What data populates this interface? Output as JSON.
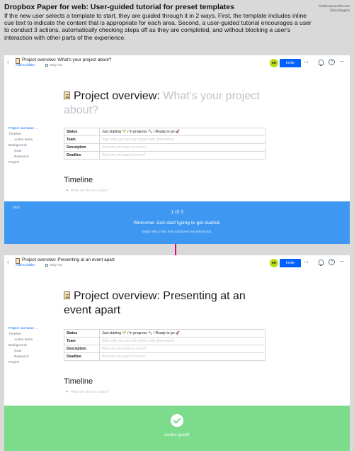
{
  "header": {
    "title": "Dropbox Paper for web: User-guided tutorial for preset templates",
    "description": "If the new user selects a template to start, they are guided through it in 2 ways. First, the template includes inline cue text to indicate the content that is appropriate for each area. Second, a user-guided tutorial encourages a user to conduct 3 actions, automatically checking steps off as they are completed, and without blocking a user's interaction with other parts of the experience.",
    "credit_line1": "firstlinesw.tumblr.com",
    "credit_line2": "@nicetriggins"
  },
  "common": {
    "add_to_folder": "Add to folder",
    "only_me": "Only me",
    "avatar_initials": "KH",
    "invite_label": "Invite",
    "back_icon": "‹",
    "star_icon": "☆",
    "more_icon": "···",
    "help_icon": "?"
  },
  "screen_a": {
    "tab_title": "Project overview: What's your project about?",
    "title_main": "Project overview: ",
    "title_placeholder": "What's your project about?",
    "toc": {
      "active": "Project overview: ...",
      "items": [
        "Timeline",
        "Action items",
        "Background",
        "Goal",
        "Research",
        "Project"
      ]
    },
    "table": [
      {
        "key": "Status",
        "value": "Just starting 🌱 / In progress 🔨 / Ready to go 🚀"
      },
      {
        "key": "Team",
        "value": "Start with you and add others with @mentions"
      },
      {
        "key": "Description",
        "value": "What do you hope to reach?"
      },
      {
        "key": "Deadline",
        "value": "What do you want to finish?"
      }
    ],
    "timeline_heading": "Timeline",
    "timeline_bullet": "What are the key dates?",
    "overlay": {
      "skip": "Skip",
      "step": "1 of 3",
      "welcome": "Welcome! Just start typing to get started.",
      "hint": "Begin with a title, then add some text below that."
    }
  },
  "screen_b": {
    "tab_title": "Project overview: Presenting at an event apart",
    "title": "Project overview: Presenting at an event apart",
    "toc": {
      "active": "Project overview: ...",
      "items": [
        "Timeline",
        "Action items",
        "Background",
        "Goal",
        "Research",
        "Project"
      ]
    },
    "table": [
      {
        "key": "Status",
        "value": "Just starting 🌱 / In progress 🔨 / Ready to go 🚀"
      },
      {
        "key": "Team",
        "value": "Start with you and add others with @mentions"
      },
      {
        "key": "Description",
        "value": "What do you hope to reach?"
      },
      {
        "key": "Deadline",
        "value": "What do you want to finish?"
      }
    ],
    "timeline_heading": "Timeline",
    "timeline_bullet": "What are the key dates?",
    "overlay": {
      "message": "Looks good!"
    }
  },
  "colors": {
    "blue_overlay": "#3e98f2",
    "green_overlay": "#7ddc8c",
    "invite": "#0061fe",
    "arrow": "#e6007e",
    "avatar": "#b4dc19"
  }
}
